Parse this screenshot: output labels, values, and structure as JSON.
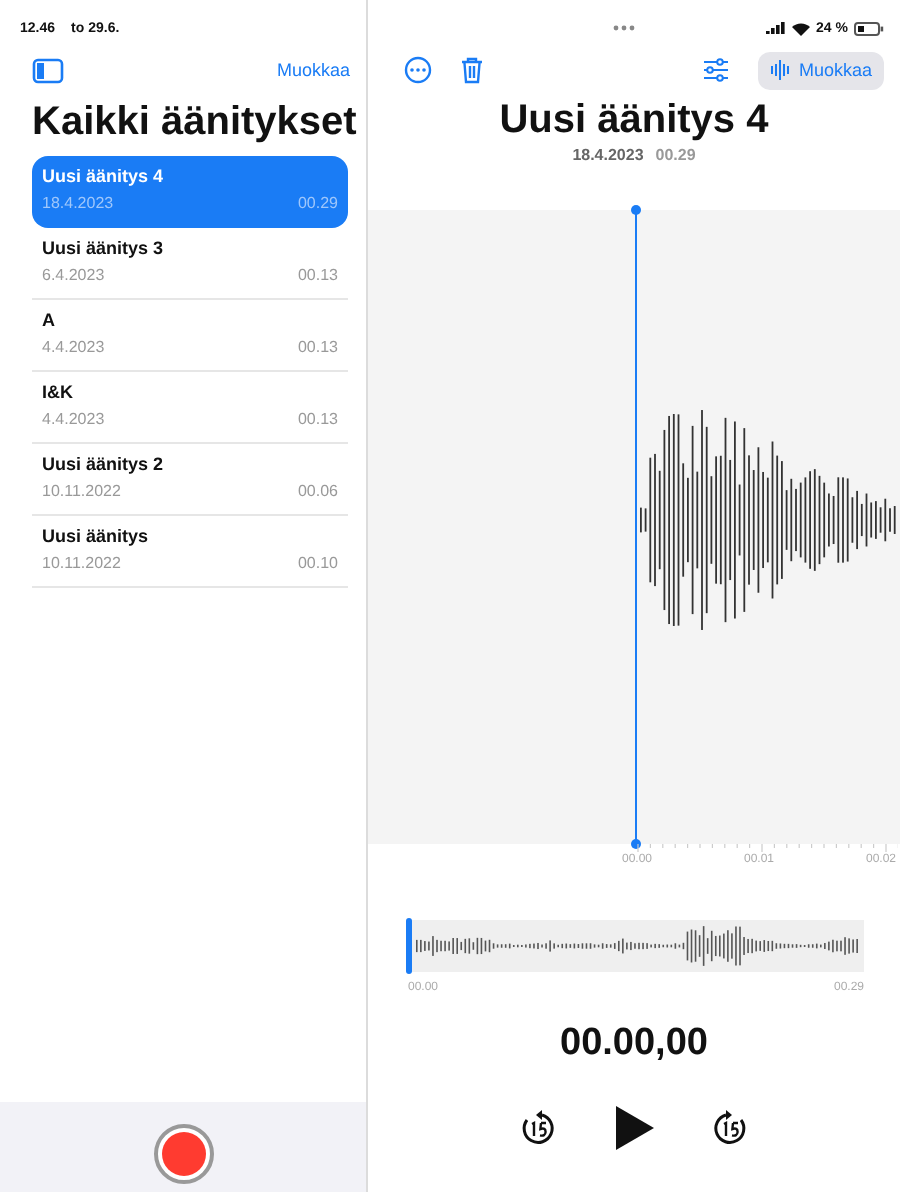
{
  "status_bar": {
    "time": "12.46",
    "date": "to 29.6.",
    "battery_text": "24 %"
  },
  "sidebar": {
    "edit_button": "Muokkaa",
    "title": "Kaikki äänitykset",
    "recordings": [
      {
        "title": "Uusi äänitys 4",
        "date": "18.4.2023",
        "duration": "00.29",
        "selected": true
      },
      {
        "title": "Uusi äänitys 3",
        "date": "6.4.2023",
        "duration": "00.13",
        "selected": false
      },
      {
        "title": "A",
        "date": "4.4.2023",
        "duration": "00.13",
        "selected": false
      },
      {
        "title": "I&K",
        "date": "4.4.2023",
        "duration": "00.13",
        "selected": false
      },
      {
        "title": "Uusi äänitys 2",
        "date": "10.11.2022",
        "duration": "00.06",
        "selected": false
      },
      {
        "title": "Uusi äänitys",
        "date": "10.11.2022",
        "duration": "00.10",
        "selected": false
      }
    ]
  },
  "detail": {
    "edit_button": "Muokkaa",
    "title": "Uusi äänitys 4",
    "date": "18.4.2023",
    "duration": "00.29",
    "timeline_labels": [
      "00.00",
      "00.01",
      "00.02"
    ],
    "overview": {
      "start": "00.00",
      "end": "00.29"
    },
    "current_time": "00.00,00"
  }
}
